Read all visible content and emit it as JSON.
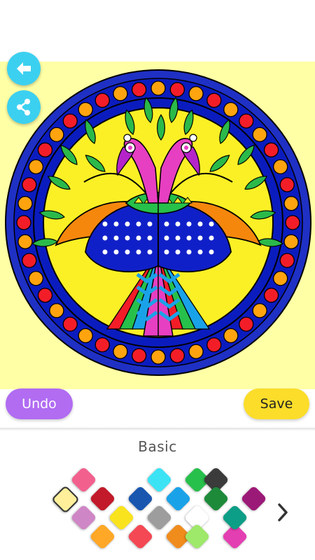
{
  "toolbar": {
    "back_icon": "back-arrow-icon",
    "share_icon": "share-icon",
    "fab_color": "#3cd0f0"
  },
  "actions": {
    "undo_label": "Undo",
    "save_label": "Save",
    "undo_color": "#b16cf2",
    "save_color": "#fbdd2a"
  },
  "palette": {
    "title": "Basic",
    "selected_index": 0,
    "next_icon": "chevron-right-icon",
    "colors": [
      "#ffef9a",
      "#f2608e",
      "#cf86c6",
      "#c21a2a",
      "#ffa726",
      "#f9e31f",
      "#1856b0",
      "#f44854",
      "#3ce3f5",
      "#9d9d9d",
      "#f08c1c",
      "#1aa2e8",
      "#27c04b",
      "#ffffff",
      "#9ee86a",
      "#3b3b3b",
      "#1d8a3a",
      "#e43fb2",
      "#9c1a77",
      "#0c9e86"
    ]
  }
}
